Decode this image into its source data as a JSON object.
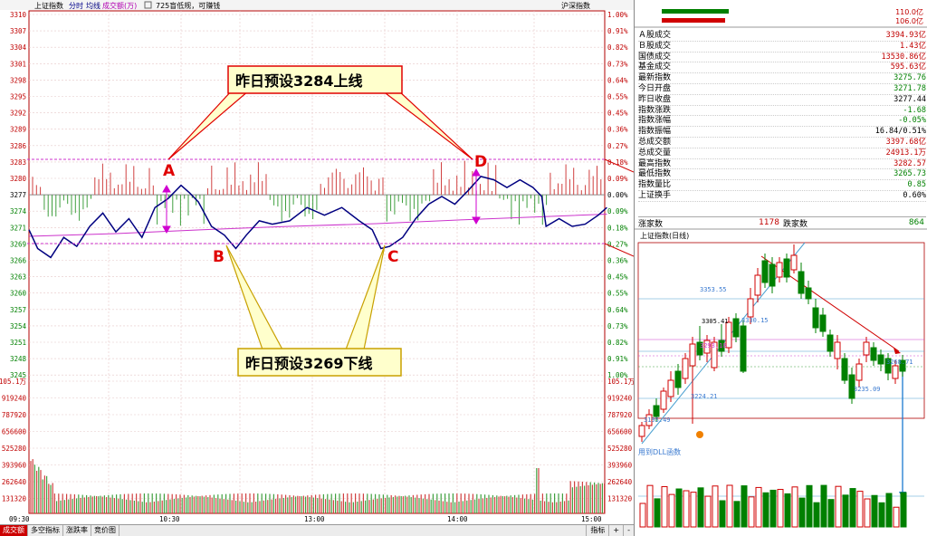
{
  "header": {
    "index_name": "上证指数",
    "tab_intraday": "分时",
    "legend_avg": "均线",
    "legend_volume": "成交额(万)",
    "notice": "725盲低规，可赚钱",
    "right_label": "沪深指数",
    "left_pct": "",
    "price_axis": [
      "3310",
      "3307",
      "3304",
      "3301",
      "3298",
      "3295",
      "3292",
      "3289",
      "3286",
      "3283",
      "3280",
      "3277",
      "3274",
      "3271",
      "3269",
      "3266",
      "3263",
      "3260",
      "3257",
      "3254",
      "3251",
      "3248",
      "3245"
    ],
    "pct_axis": [
      "1.00%",
      "0.91%",
      "0.82%",
      "0.73%",
      "0.64%",
      "0.55%",
      "0.45%",
      "0.36%",
      "0.27%",
      "0.18%",
      "0.09%",
      "0.00%",
      "0.09%",
      "0.18%",
      "0.27%",
      "0.36%",
      "0.45%",
      "0.55%",
      "0.64%",
      "0.73%",
      "0.82%",
      "0.91%",
      "1.00%"
    ],
    "vol_axis": [
      "105.1万",
      "919240",
      "787920",
      "656600",
      "525280",
      "393960",
      "262640",
      "131320"
    ],
    "time_axis": [
      "09:30",
      "10:30",
      "13:00",
      "14:00",
      "15:00"
    ]
  },
  "annotations": {
    "top_callout": "昨日预设3284上线",
    "bottom_callout": "昨日预设3269下线",
    "point_a": "A",
    "point_b": "B",
    "point_c": "C",
    "point_d": "D"
  },
  "tabs": [
    "成交额",
    "多空指标",
    "涨跌率",
    "竞价图"
  ],
  "tools": {
    "indicator": "指标",
    "plus": "+",
    "minus": "-"
  },
  "side": {
    "top_values": [
      "110.0亿",
      "106.0亿"
    ],
    "stats": [
      {
        "label": "Ａ股成交",
        "value": "3394.93亿",
        "color": "#c00000"
      },
      {
        "label": "Ｂ股成交",
        "value": "1.43亿",
        "color": "#c00000"
      },
      {
        "label": "国债成交",
        "value": "13530.86亿",
        "color": "#c00000"
      },
      {
        "label": "基金成交",
        "value": "595.63亿",
        "color": "#c00000"
      },
      {
        "label": "最新指数",
        "value": "3275.76",
        "color": "#008000"
      },
      {
        "label": "今日开盘",
        "value": "3271.78",
        "color": "#008000"
      },
      {
        "label": "昨日收盘",
        "value": "3277.44",
        "color": "#000000"
      },
      {
        "label": "指数涨跌",
        "value": "-1.68",
        "color": "#008000"
      },
      {
        "label": "指数涨幅",
        "value": "-0.05%",
        "color": "#008000"
      },
      {
        "label": "指数振幅",
        "value": "16.84/0.51%",
        "color": "#000000"
      },
      {
        "label": "总成交额",
        "value": "3397.68亿",
        "color": "#c00000"
      },
      {
        "label": "总成交量",
        "value": "24913.1万",
        "color": "#c00000"
      },
      {
        "label": "最高指数",
        "value": "3282.57",
        "color": "#c00000"
      },
      {
        "label": "最低指数",
        "value": "3265.73",
        "color": "#008000"
      },
      {
        "label": "指数量比",
        "value": "0.85",
        "color": "#008000"
      },
      {
        "label": "上证换手",
        "value": "0.60%",
        "color": "#000000"
      }
    ],
    "up_label": "涨家数",
    "up_value": "1178",
    "down_label": "跌家数",
    "down_value": "864",
    "kline_title": "上证指数(日线)",
    "kline_labels": [
      "3353.55",
      "3330.15",
      "3305.41",
      "3293.18",
      "3224.21",
      "3195.49",
      "3235.09",
      "3268.71"
    ],
    "indicator_name": "用到DLL函数"
  }
}
